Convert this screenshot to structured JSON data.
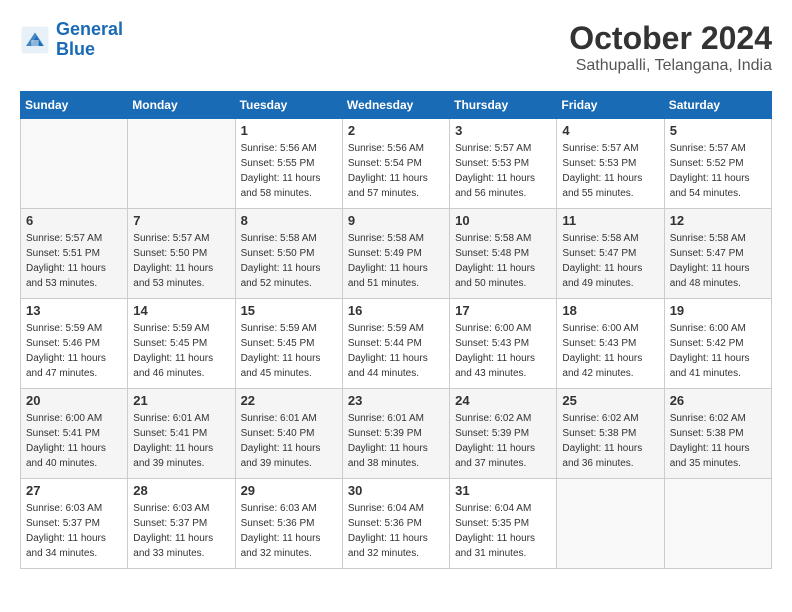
{
  "header": {
    "logo_line1": "General",
    "logo_line2": "Blue",
    "month": "October 2024",
    "location": "Sathupalli, Telangana, India"
  },
  "days_of_week": [
    "Sunday",
    "Monday",
    "Tuesday",
    "Wednesday",
    "Thursday",
    "Friday",
    "Saturday"
  ],
  "weeks": [
    [
      {
        "day": "",
        "sunrise": "",
        "sunset": "",
        "daylight": ""
      },
      {
        "day": "",
        "sunrise": "",
        "sunset": "",
        "daylight": ""
      },
      {
        "day": "1",
        "sunrise": "Sunrise: 5:56 AM",
        "sunset": "Sunset: 5:55 PM",
        "daylight": "Daylight: 11 hours and 58 minutes."
      },
      {
        "day": "2",
        "sunrise": "Sunrise: 5:56 AM",
        "sunset": "Sunset: 5:54 PM",
        "daylight": "Daylight: 11 hours and 57 minutes."
      },
      {
        "day": "3",
        "sunrise": "Sunrise: 5:57 AM",
        "sunset": "Sunset: 5:53 PM",
        "daylight": "Daylight: 11 hours and 56 minutes."
      },
      {
        "day": "4",
        "sunrise": "Sunrise: 5:57 AM",
        "sunset": "Sunset: 5:53 PM",
        "daylight": "Daylight: 11 hours and 55 minutes."
      },
      {
        "day": "5",
        "sunrise": "Sunrise: 5:57 AM",
        "sunset": "Sunset: 5:52 PM",
        "daylight": "Daylight: 11 hours and 54 minutes."
      }
    ],
    [
      {
        "day": "6",
        "sunrise": "Sunrise: 5:57 AM",
        "sunset": "Sunset: 5:51 PM",
        "daylight": "Daylight: 11 hours and 53 minutes."
      },
      {
        "day": "7",
        "sunrise": "Sunrise: 5:57 AM",
        "sunset": "Sunset: 5:50 PM",
        "daylight": "Daylight: 11 hours and 53 minutes."
      },
      {
        "day": "8",
        "sunrise": "Sunrise: 5:58 AM",
        "sunset": "Sunset: 5:50 PM",
        "daylight": "Daylight: 11 hours and 52 minutes."
      },
      {
        "day": "9",
        "sunrise": "Sunrise: 5:58 AM",
        "sunset": "Sunset: 5:49 PM",
        "daylight": "Daylight: 11 hours and 51 minutes."
      },
      {
        "day": "10",
        "sunrise": "Sunrise: 5:58 AM",
        "sunset": "Sunset: 5:48 PM",
        "daylight": "Daylight: 11 hours and 50 minutes."
      },
      {
        "day": "11",
        "sunrise": "Sunrise: 5:58 AM",
        "sunset": "Sunset: 5:47 PM",
        "daylight": "Daylight: 11 hours and 49 minutes."
      },
      {
        "day": "12",
        "sunrise": "Sunrise: 5:58 AM",
        "sunset": "Sunset: 5:47 PM",
        "daylight": "Daylight: 11 hours and 48 minutes."
      }
    ],
    [
      {
        "day": "13",
        "sunrise": "Sunrise: 5:59 AM",
        "sunset": "Sunset: 5:46 PM",
        "daylight": "Daylight: 11 hours and 47 minutes."
      },
      {
        "day": "14",
        "sunrise": "Sunrise: 5:59 AM",
        "sunset": "Sunset: 5:45 PM",
        "daylight": "Daylight: 11 hours and 46 minutes."
      },
      {
        "day": "15",
        "sunrise": "Sunrise: 5:59 AM",
        "sunset": "Sunset: 5:45 PM",
        "daylight": "Daylight: 11 hours and 45 minutes."
      },
      {
        "day": "16",
        "sunrise": "Sunrise: 5:59 AM",
        "sunset": "Sunset: 5:44 PM",
        "daylight": "Daylight: 11 hours and 44 minutes."
      },
      {
        "day": "17",
        "sunrise": "Sunrise: 6:00 AM",
        "sunset": "Sunset: 5:43 PM",
        "daylight": "Daylight: 11 hours and 43 minutes."
      },
      {
        "day": "18",
        "sunrise": "Sunrise: 6:00 AM",
        "sunset": "Sunset: 5:43 PM",
        "daylight": "Daylight: 11 hours and 42 minutes."
      },
      {
        "day": "19",
        "sunrise": "Sunrise: 6:00 AM",
        "sunset": "Sunset: 5:42 PM",
        "daylight": "Daylight: 11 hours and 41 minutes."
      }
    ],
    [
      {
        "day": "20",
        "sunrise": "Sunrise: 6:00 AM",
        "sunset": "Sunset: 5:41 PM",
        "daylight": "Daylight: 11 hours and 40 minutes."
      },
      {
        "day": "21",
        "sunrise": "Sunrise: 6:01 AM",
        "sunset": "Sunset: 5:41 PM",
        "daylight": "Daylight: 11 hours and 39 minutes."
      },
      {
        "day": "22",
        "sunrise": "Sunrise: 6:01 AM",
        "sunset": "Sunset: 5:40 PM",
        "daylight": "Daylight: 11 hours and 39 minutes."
      },
      {
        "day": "23",
        "sunrise": "Sunrise: 6:01 AM",
        "sunset": "Sunset: 5:39 PM",
        "daylight": "Daylight: 11 hours and 38 minutes."
      },
      {
        "day": "24",
        "sunrise": "Sunrise: 6:02 AM",
        "sunset": "Sunset: 5:39 PM",
        "daylight": "Daylight: 11 hours and 37 minutes."
      },
      {
        "day": "25",
        "sunrise": "Sunrise: 6:02 AM",
        "sunset": "Sunset: 5:38 PM",
        "daylight": "Daylight: 11 hours and 36 minutes."
      },
      {
        "day": "26",
        "sunrise": "Sunrise: 6:02 AM",
        "sunset": "Sunset: 5:38 PM",
        "daylight": "Daylight: 11 hours and 35 minutes."
      }
    ],
    [
      {
        "day": "27",
        "sunrise": "Sunrise: 6:03 AM",
        "sunset": "Sunset: 5:37 PM",
        "daylight": "Daylight: 11 hours and 34 minutes."
      },
      {
        "day": "28",
        "sunrise": "Sunrise: 6:03 AM",
        "sunset": "Sunset: 5:37 PM",
        "daylight": "Daylight: 11 hours and 33 minutes."
      },
      {
        "day": "29",
        "sunrise": "Sunrise: 6:03 AM",
        "sunset": "Sunset: 5:36 PM",
        "daylight": "Daylight: 11 hours and 32 minutes."
      },
      {
        "day": "30",
        "sunrise": "Sunrise: 6:04 AM",
        "sunset": "Sunset: 5:36 PM",
        "daylight": "Daylight: 11 hours and 32 minutes."
      },
      {
        "day": "31",
        "sunrise": "Sunrise: 6:04 AM",
        "sunset": "Sunset: 5:35 PM",
        "daylight": "Daylight: 11 hours and 31 minutes."
      },
      {
        "day": "",
        "sunrise": "",
        "sunset": "",
        "daylight": ""
      },
      {
        "day": "",
        "sunrise": "",
        "sunset": "",
        "daylight": ""
      }
    ]
  ]
}
